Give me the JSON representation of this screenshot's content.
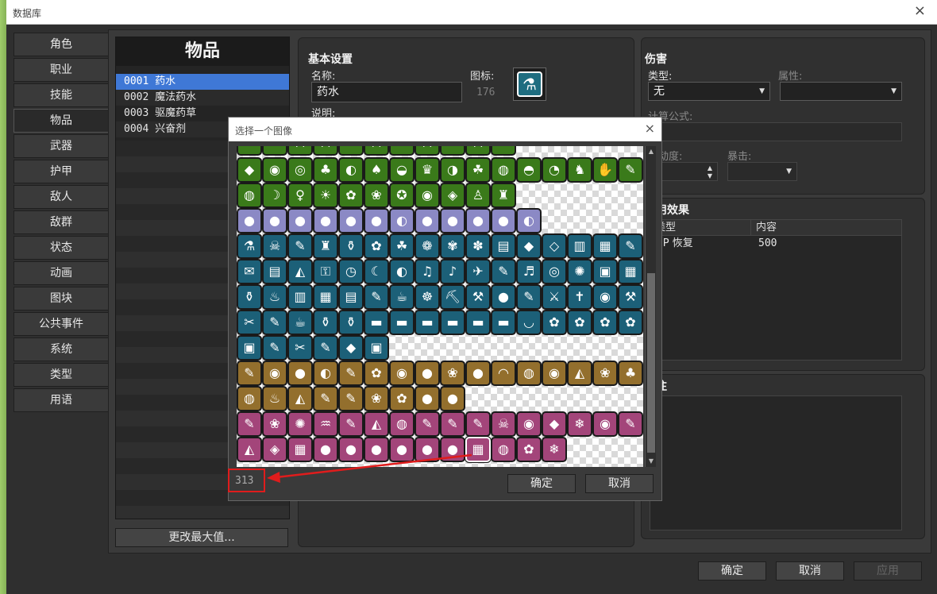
{
  "window": {
    "title": "数据库",
    "close_icon": "×"
  },
  "categories": [
    "角色",
    "职业",
    "技能",
    "物品",
    "武器",
    "护甲",
    "敌人",
    "敌群",
    "状态",
    "动画",
    "图块",
    "公共事件",
    "系统",
    "类型",
    "用语"
  ],
  "active_category": "物品",
  "item_list": {
    "header": "物品",
    "items": [
      "0001 药水",
      "0002 魔法药水",
      "0003 驱魔药草",
      "0004 兴奋剂"
    ],
    "selected": "0001 药水",
    "change_max_button": "更改最大值..."
  },
  "basic": {
    "section": "基本设置",
    "name_label": "名称:",
    "name_value": "药水",
    "icon_label": "图标:",
    "icon_index": "176",
    "desc_label": "说明:"
  },
  "damage": {
    "section": "伤害",
    "type_label": "类型:",
    "type_value": "无",
    "element_label": "属性:",
    "formula_label": "计算公式:",
    "variance_label": "波动度:",
    "critical_label": "暴击:"
  },
  "effects": {
    "section": "使用效果",
    "col_type": "类型",
    "col_content": "内容",
    "rows": [
      {
        "type": "HP 恢复",
        "content": "500"
      }
    ]
  },
  "notes": {
    "section": "备注"
  },
  "bottom_buttons": {
    "ok": "确定",
    "cancel": "取消",
    "apply": "应用"
  },
  "modal": {
    "title": "选择一个图像",
    "close_icon": "×",
    "selected_index": "313",
    "ok": "确定",
    "cancel": "取消",
    "icon_rows": [
      {
        "color": "g",
        "count": 11,
        "glyphs": [
          "✎",
          "✎",
          "⚔",
          "⚔",
          "✎",
          "⚔",
          "✎",
          "⚔",
          "✎",
          "⚔",
          "✎"
        ]
      },
      {
        "color": "g",
        "count": 16,
        "glyphs": [
          "◆",
          "◉",
          "◎",
          "♣",
          "◐",
          "♠",
          "◒",
          "♛",
          "◑",
          "☘",
          "◍",
          "◓",
          "◔",
          "♞",
          "✋",
          "✎"
        ]
      },
      {
        "color": "g",
        "count": 11,
        "glyphs": [
          "◍",
          "☽",
          "♀",
          "☀",
          "✿",
          "❀",
          "✪",
          "◉",
          "◈",
          "♙",
          "♜"
        ]
      },
      {
        "color": "p",
        "count": 12,
        "glyphs": [
          "●",
          "●",
          "●",
          "●",
          "●",
          "●",
          "◐",
          "●",
          "●",
          "●",
          "●",
          "◐"
        ]
      },
      {
        "color": "b",
        "count": 16,
        "glyphs": [
          "⚗",
          "☠",
          "✎",
          "♜",
          "⚱",
          "✿",
          "☘",
          "❁",
          "✾",
          "✽",
          "▤",
          "◆",
          "◇",
          "▥",
          "▦",
          "✎"
        ]
      },
      {
        "color": "b",
        "count": 16,
        "glyphs": [
          "✉",
          "▤",
          "◭",
          "⚿",
          "◷",
          "☾",
          "◐",
          "♫",
          "♪",
          "✈",
          "✎",
          "♬",
          "◎",
          "✺",
          "▣",
          "▦"
        ]
      },
      {
        "color": "b",
        "count": 16,
        "glyphs": [
          "⚱",
          "♨",
          "▥",
          "▦",
          "▤",
          "✎",
          "☕",
          "☸",
          "⛏",
          "⚒",
          "●",
          "✎",
          "⚔",
          "✝",
          "◉",
          "⚒"
        ]
      },
      {
        "color": "b",
        "count": 16,
        "glyphs": [
          "✂",
          "✎",
          "☕",
          "⚱",
          "⚱",
          "▬",
          "▬",
          "▬",
          "▬",
          "▬",
          "▬",
          "◡",
          "✿",
          "✿",
          "✿",
          "✿"
        ]
      },
      {
        "color": "b",
        "count": 6,
        "glyphs": [
          "▣",
          "✎",
          "✂",
          "✎",
          "◆",
          "▣"
        ]
      },
      {
        "color": "o",
        "count": 16,
        "glyphs": [
          "✎",
          "◉",
          "●",
          "◐",
          "✎",
          "✿",
          "◉",
          "●",
          "❀",
          "●",
          "◠",
          "◍",
          "◉",
          "◭",
          "❀",
          "♣"
        ]
      },
      {
        "color": "o",
        "count": 9,
        "glyphs": [
          "◍",
          "♨",
          "◭",
          "✎",
          "✎",
          "❀",
          "✿",
          "●",
          "●"
        ]
      },
      {
        "color": "m",
        "count": 16,
        "glyphs": [
          "✎",
          "❀",
          "✺",
          "♒",
          "✎",
          "◭",
          "◍",
          "✎",
          "✎",
          "✎",
          "☠",
          "◉",
          "◆",
          "❄",
          "◉",
          "✎"
        ]
      },
      {
        "color": "m",
        "count": 13,
        "glyphs": [
          "◭",
          "◈",
          "▦",
          "●",
          "●",
          "●",
          "●",
          "●",
          "●",
          "▦",
          "◍",
          "✿",
          "❄"
        ]
      }
    ]
  }
}
